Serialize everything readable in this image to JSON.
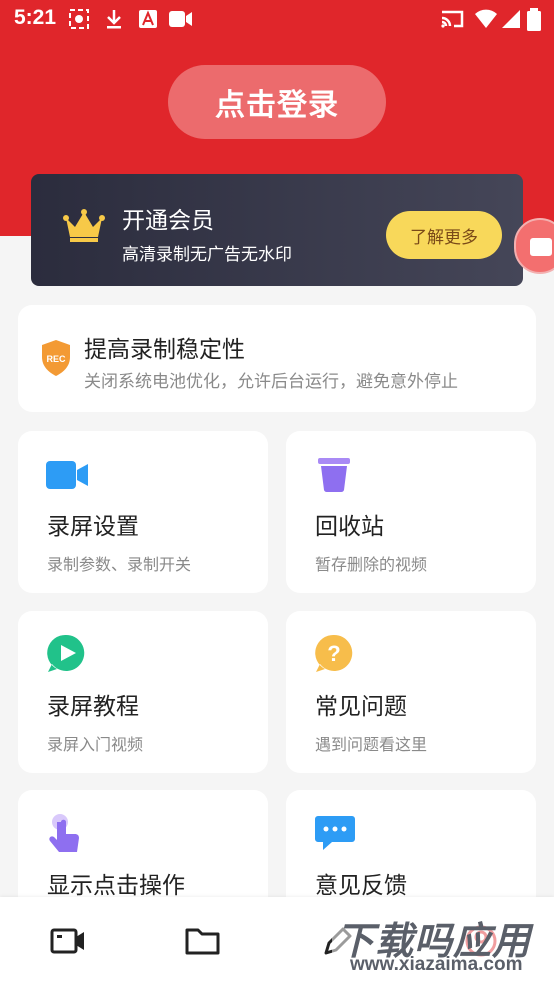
{
  "status_bar": {
    "time": "5:21"
  },
  "header": {
    "login_label": "点击登录",
    "color": "#e0262b"
  },
  "vip": {
    "title": "开通会员",
    "subtitle": "高清录制无广告无水印",
    "button_label": "了解更多"
  },
  "stability": {
    "icon_text": "REC",
    "title": "提高录制稳定性",
    "subtitle": "关闭系统电池优化，允许后台运行，避免意外停止"
  },
  "tiles": [
    {
      "title": "录屏设置",
      "subtitle": "录制参数、录制开关",
      "icon": "video-camera-icon"
    },
    {
      "title": "回收站",
      "subtitle": "暂存删除的视频",
      "icon": "trash-icon"
    },
    {
      "title": "录屏教程",
      "subtitle": "录屏入门视频",
      "icon": "play-icon"
    },
    {
      "title": "常见问题",
      "subtitle": "遇到问题看这里",
      "icon": "question-icon"
    },
    {
      "title": "显示点击操作",
      "subtitle": "",
      "icon": "tap-hand-icon"
    },
    {
      "title": "意见反馈",
      "subtitle": "",
      "icon": "feedback-chat-icon"
    }
  ],
  "bottom_nav": {
    "items": [
      "video-tab-icon",
      "folder-tab-icon",
      "edit-tab-icon",
      "profile-tab-icon"
    ]
  },
  "watermark": {
    "title": "下载吗应用",
    "url": "www.xiazaima.com"
  }
}
